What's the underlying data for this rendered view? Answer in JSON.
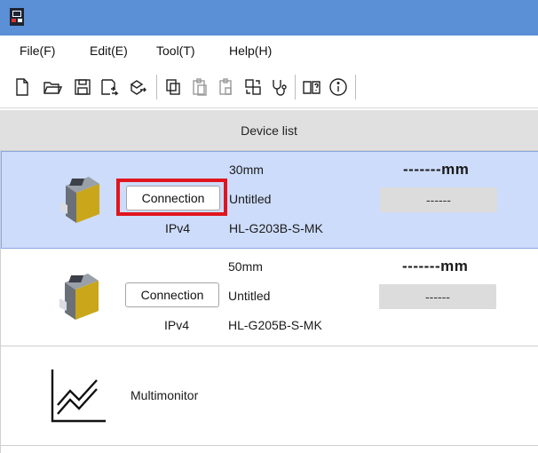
{
  "menu": [
    "File(F)",
    "Edit(E)",
    "Tool(T)",
    "Help(H)"
  ],
  "toolbar": {
    "icons": [
      "new-file-icon",
      "open-folder-icon",
      "save-icon",
      "save-as-icon",
      "export-icon",
      "copy-icon",
      "paste-icon",
      "paste-special-icon",
      "compare-icon",
      "diagnose-icon",
      "manual-icon",
      "info-icon"
    ]
  },
  "list_header": "Device list",
  "devices": [
    {
      "range": "30mm",
      "name": "Untitled",
      "protocol": "IPv4",
      "model": "HL-G203B-S-MK",
      "measurement": "-------mm",
      "status": "------",
      "button": "Connection",
      "selected": true
    },
    {
      "range": "50mm",
      "name": "Untitled",
      "protocol": "IPv4",
      "model": "HL-G205B-S-MK",
      "measurement": "-------mm",
      "status": "------",
      "button": "Connection",
      "selected": false
    }
  ],
  "multimonitor": {
    "label": "Multimonitor"
  },
  "colors": {
    "titlebar": "#5b8fd6",
    "selected_row": "#cddcfb",
    "highlight": "#e0151e",
    "header": "#e0e0e0"
  }
}
